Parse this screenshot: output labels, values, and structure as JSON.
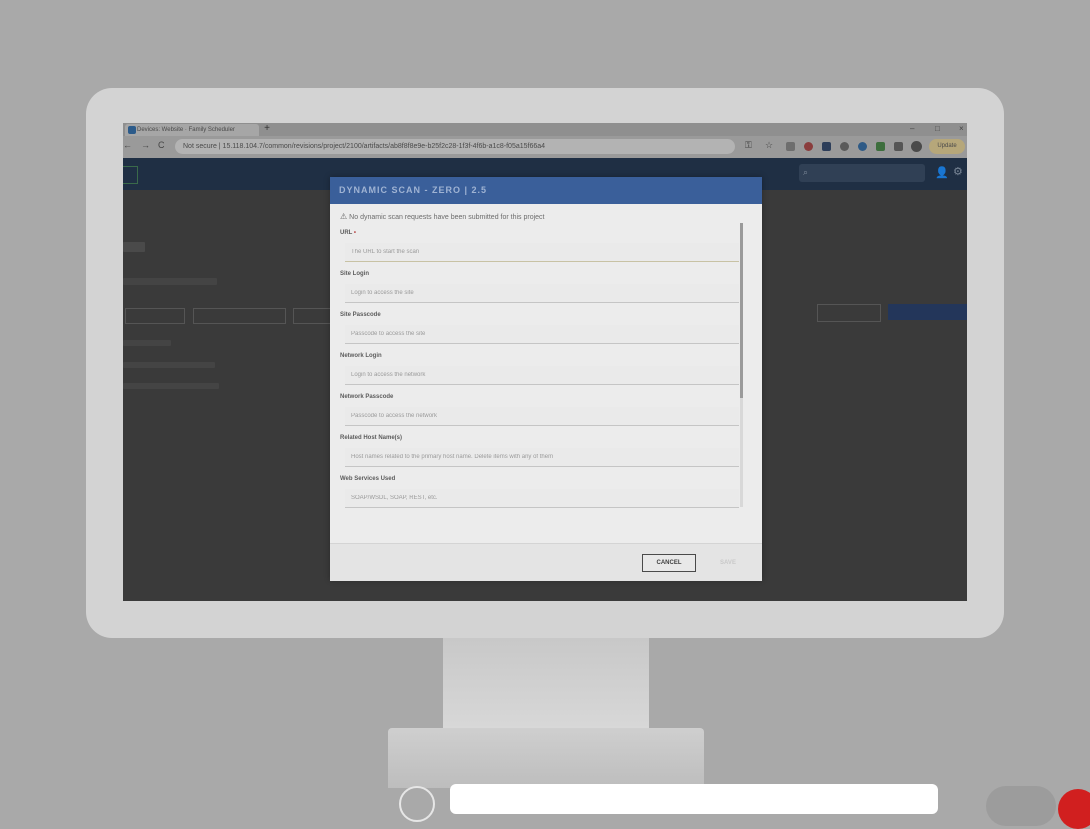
{
  "browser": {
    "tab_title": "Devices: Website · Family Scheduler",
    "new_tab": "+",
    "min": "–",
    "max": "□",
    "close": "×",
    "back": "←",
    "forward": "→",
    "reload": "C",
    "url": "Not secure | 15.118.104.7/common/revisions/project/2100/artifacts/ab8f8f8e9e-b25f2c28-1f3f-4f6b-a1c8-f05a15f66a4",
    "update_label": "Update"
  },
  "modal": {
    "title": "DYNAMIC SCAN - ZERO | 2.5",
    "warning": "No dynamic scan requests have been submitted for this project",
    "fields": [
      {
        "label": "URL",
        "required": true,
        "placeholder": "The URL to start the scan"
      },
      {
        "label": "Site Login",
        "placeholder": "Login to access the site"
      },
      {
        "label": "Site Passcode",
        "placeholder": "Passcode to access the site"
      },
      {
        "label": "Network Login",
        "placeholder": "Login to access the network"
      },
      {
        "label": "Network Passcode",
        "placeholder": "Passcode to access the network"
      },
      {
        "label": "Related Host Name(s)",
        "placeholder": "Host names related to the primary host name. Delete items with any of them"
      },
      {
        "label": "Web Services Used",
        "placeholder": "SOAP/WSDL, SOAP, REST, etc."
      }
    ],
    "required_marker": "•",
    "cancel_label": "CANCEL",
    "save_label": "SAVE"
  },
  "colors": {
    "modal_header": "#3a5f9a",
    "app_header": "#1f2f44",
    "required": "#b84a4a",
    "overlay_red": "#d11f1f"
  },
  "icons": [
    "warning-icon",
    "search-icon",
    "user-icon",
    "gear-icon",
    "reload-icon",
    "lock-icon",
    "star-icon"
  ]
}
